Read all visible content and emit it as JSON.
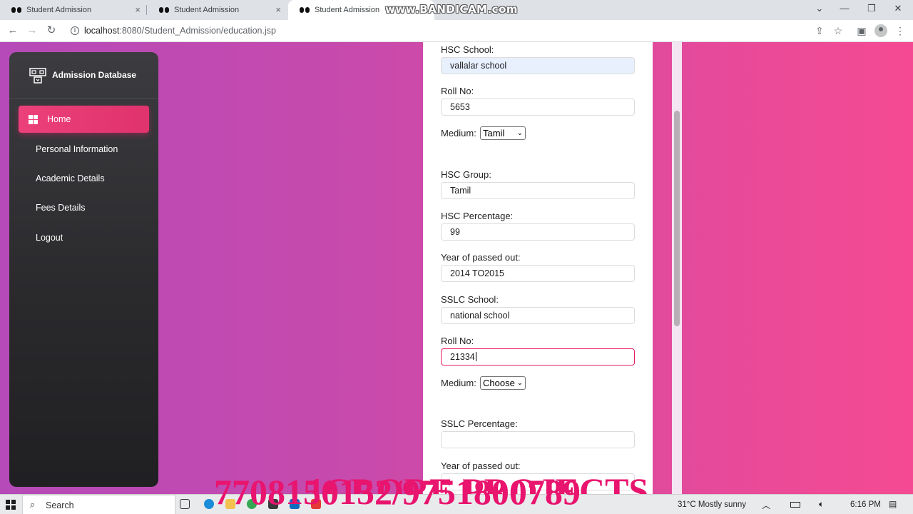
{
  "browser": {
    "tabs": [
      {
        "title": "Student Admission",
        "close": "×"
      },
      {
        "title": "Student Admission",
        "close": "×"
      },
      {
        "title": "Student Admission",
        "close": "×"
      }
    ],
    "recorder_watermark": "www.BANDICAM.com",
    "url_host": "localhost",
    "url_path": ":8080/Student_Admission/education.jsp",
    "window_controls": {
      "chevron": "⌄",
      "minimize": "—",
      "restore": "❐",
      "close": "✕"
    },
    "nav": {
      "back": "←",
      "forward": "→",
      "reload": "↻"
    },
    "toolbar_icons": {
      "share": "⇪",
      "star": "☆",
      "sidebar": "▣",
      "menu": "⋮"
    }
  },
  "sidebar": {
    "title": "Admission Database",
    "items": [
      {
        "label": "Home"
      },
      {
        "label": "Personal Information"
      },
      {
        "label": "Academic Details"
      },
      {
        "label": "Fees Details"
      },
      {
        "label": "Logout"
      }
    ]
  },
  "form": {
    "hsc_school_label": "HSC School:",
    "hsc_school_value": "vallalar school",
    "hsc_roll_label": "Roll No:",
    "hsc_roll_value": "5653",
    "hsc_medium_label": "Medium:",
    "hsc_medium_selected": "Tamil",
    "hsc_group_label": "HSC Group:",
    "hsc_group_value": "Tamil",
    "hsc_percentage_label": "HSC Percentage:",
    "hsc_percentage_value": "99",
    "hsc_year_label": "Year of passed out:",
    "hsc_year_value": "2014 TO2015",
    "sslc_school_label": "SSLC School:",
    "sslc_school_value": "national school",
    "sslc_roll_label": "Roll No:",
    "sslc_roll_value": "21334",
    "sslc_medium_label": "Medium:",
    "sslc_medium_selected": "Choose",
    "sslc_percentage_label": "SSLC Percentage:",
    "sslc_year_label": "Year of passed out:",
    "chevron": "⌄"
  },
  "overlay": {
    "line1": "1CRORE PROJECTS",
    "line2": "7708150152/9751800789"
  },
  "taskbar": {
    "search_label": "Search",
    "weather": "31°C  Mostly sunny",
    "clock": "6:16 PM",
    "tray": {
      "chevron": "︿",
      "notifications": "▤"
    }
  }
}
